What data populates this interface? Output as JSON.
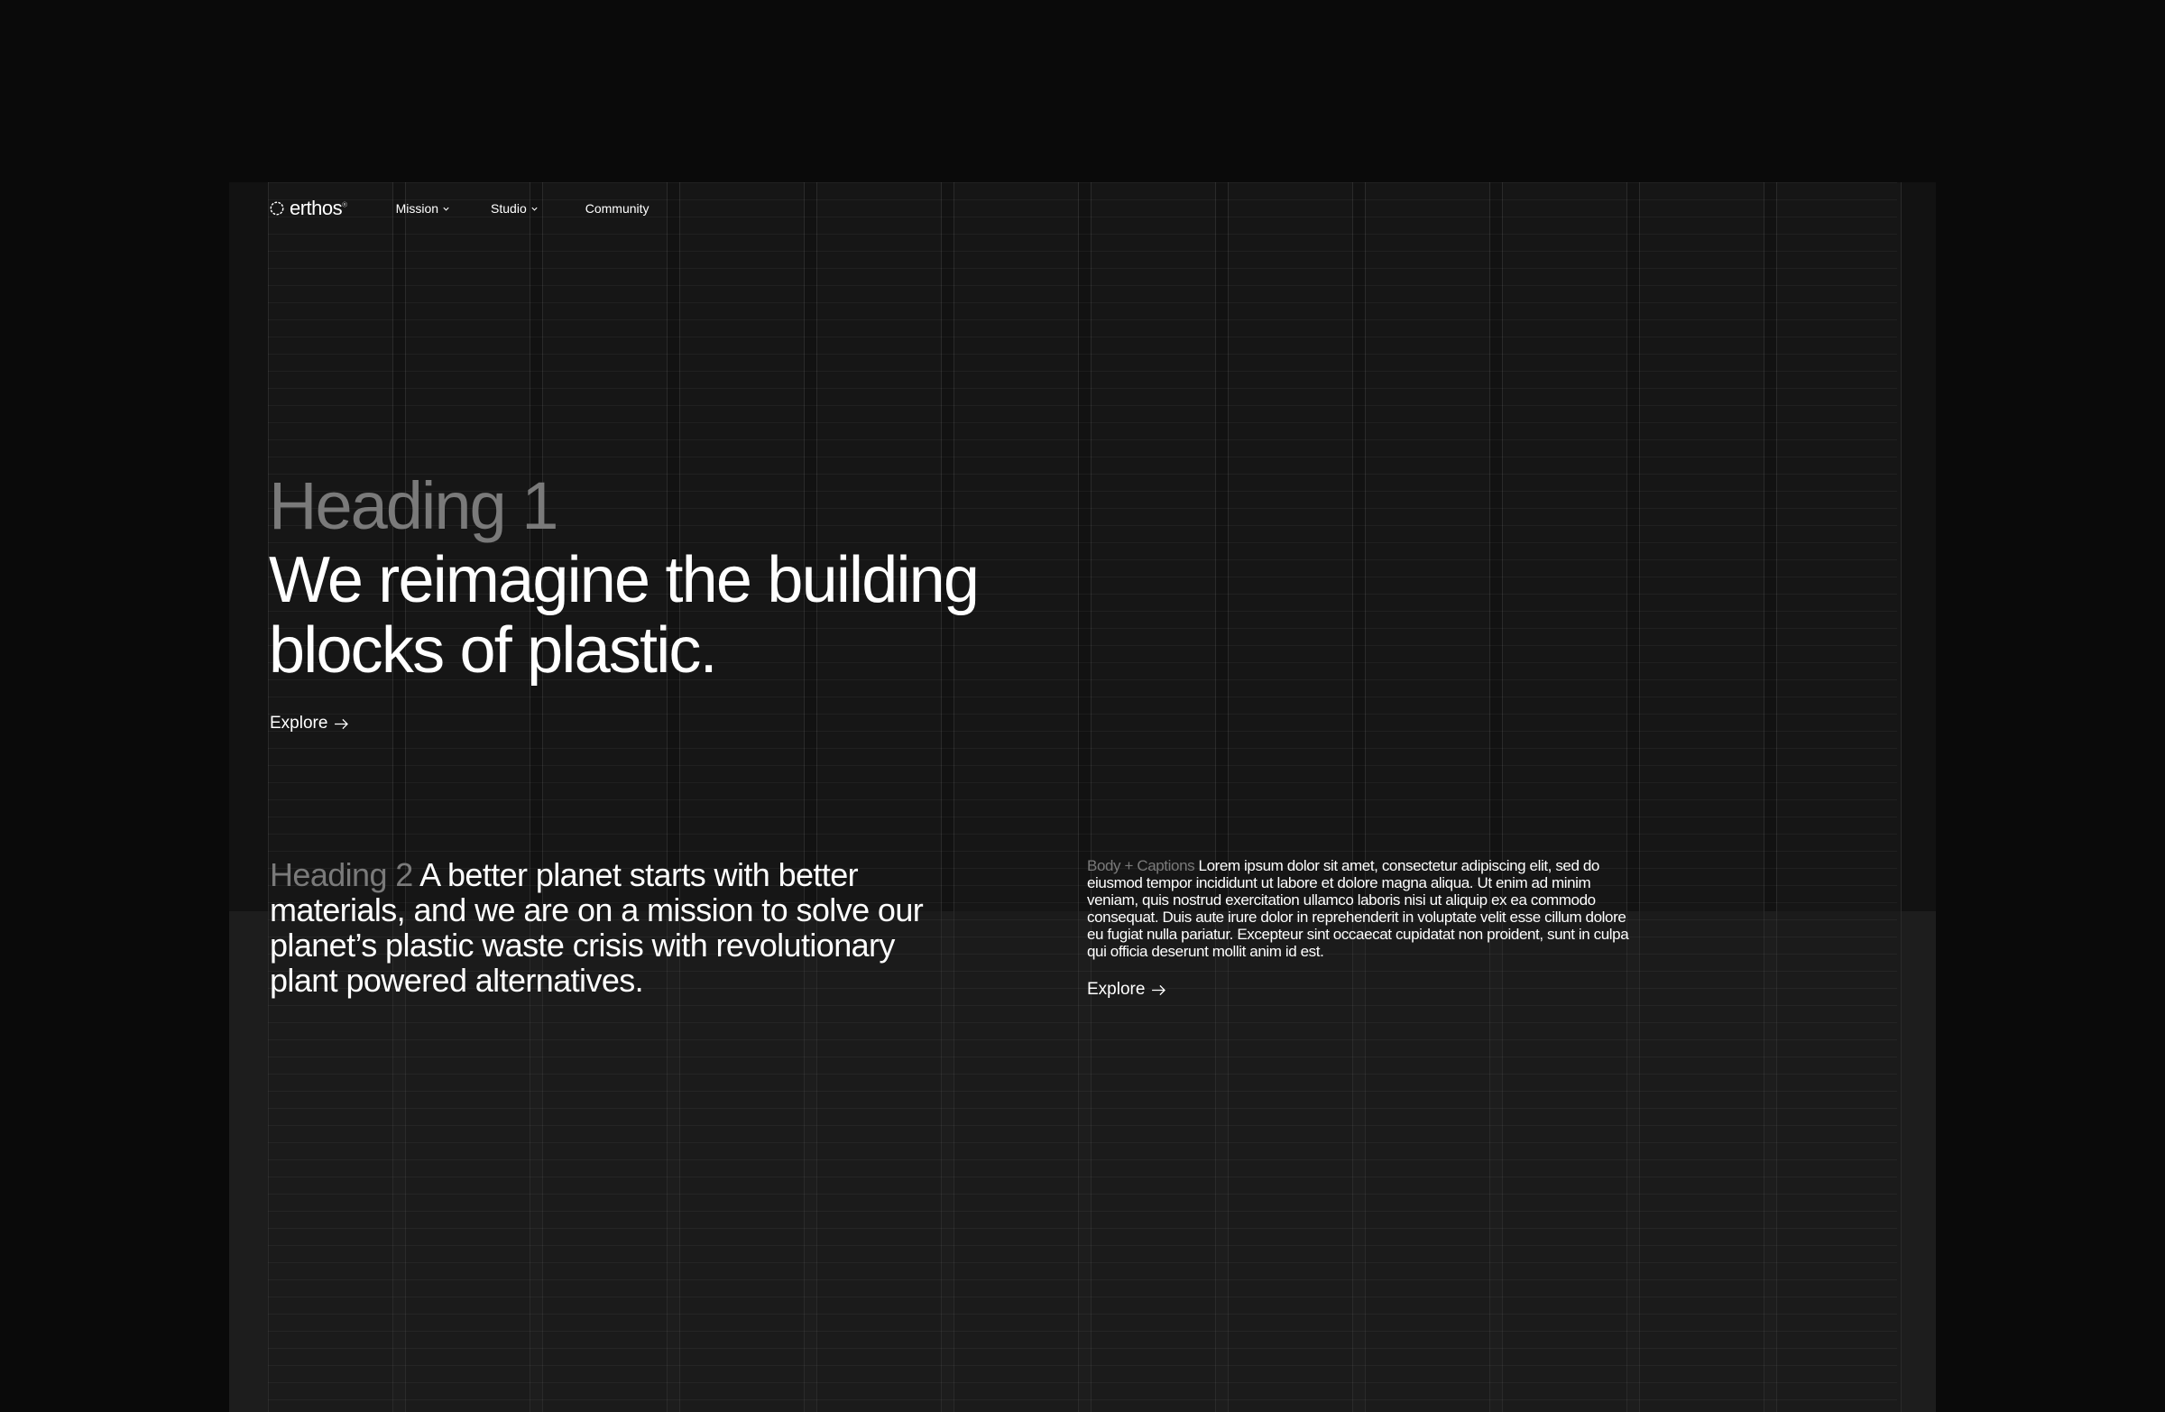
{
  "nav": {
    "logo_text": "erthos",
    "logo_reg": "®",
    "items": [
      {
        "label": "Mission",
        "has_dropdown": true
      },
      {
        "label": "Studio",
        "has_dropdown": true
      },
      {
        "label": "Community",
        "has_dropdown": false
      }
    ]
  },
  "hero": {
    "label": "Heading 1",
    "title": "We reimagine the building blocks of plastic.",
    "cta": "Explore"
  },
  "heading2": {
    "label": "Heading 2",
    "text": "A better planet starts with better materials, and we are on a mission to solve our planet’s plastic waste crisis with revolutionary plant powered alternatives."
  },
  "body_caption": {
    "label": "Body + Captions",
    "text": "Lorem ipsum dolor sit amet, consectetur adipiscing elit, sed do eiusmod tempor incididunt ut labore et dolore magna aliqua. Ut enim ad minim veniam, quis nostrud exercitation ullamco laboris nisi ut aliquip ex ea commodo consequat. Duis aute irure dolor in reprehenderit in voluptate velit esse cillum dolore eu fugiat nulla pariatur. Excepteur sint occaecat cupidatat non proident, sunt in culpa qui officia deserunt mollit anim id est.",
    "cta": "Explore"
  },
  "icons": {
    "logo": "logo-ring-icon",
    "dropdown": "chevron-down-icon",
    "cta": "arrow-right-icon"
  },
  "colors": {
    "page_background": "#0a0a0a",
    "frame_background": "#121212",
    "lower_section": "#1d1d1d",
    "label_gray": "#7a7a7a",
    "text": "#ffffff"
  }
}
